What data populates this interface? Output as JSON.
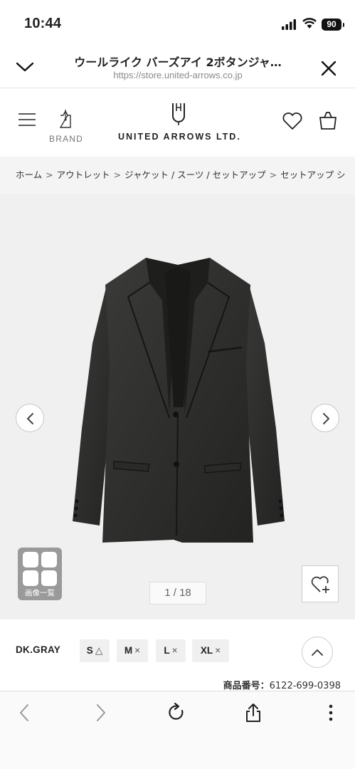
{
  "status_bar": {
    "time": "10:44",
    "battery": "90"
  },
  "browser": {
    "title": "ウールライク バーズアイ 2ボタンジャ…",
    "url": "https://store.united-arrows.co.jp"
  },
  "site_header": {
    "brand_label": "BRAND",
    "logo_text": "UNITED ARROWS LTD."
  },
  "breadcrumb": {
    "items": [
      "ホーム",
      "アウトレット",
      "ジャケット / スーツ / セットアップ",
      "セットアップ シ"
    ],
    "separator": ">"
  },
  "gallery": {
    "thumbs_label": "画像一覧",
    "counter": "1 / 18"
  },
  "variant": {
    "color": "DK.GRAY",
    "sizes": [
      {
        "label": "S",
        "mark": "△"
      },
      {
        "label": "M",
        "mark": "×"
      },
      {
        "label": "L",
        "mark": "×"
      },
      {
        "label": "XL",
        "mark": "×"
      }
    ]
  },
  "product": {
    "code_label": "商品番号：",
    "code_value": "6122-699-0398"
  },
  "colors": {
    "jacket": "#2b2b2a",
    "background": "#f0f0f0",
    "battery": "#111111"
  }
}
